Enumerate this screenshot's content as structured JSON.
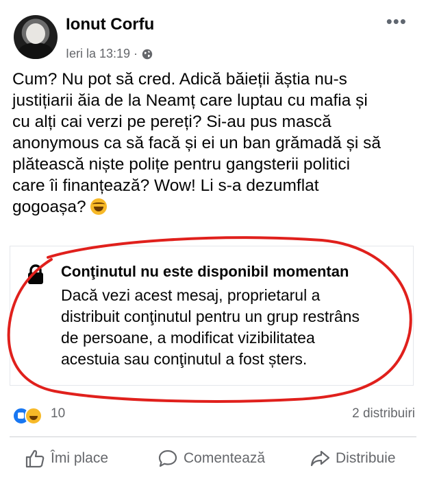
{
  "post": {
    "author": "Ionut Corfu",
    "timestamp": "Ieri la 13:19 ·",
    "more_label": "•••",
    "text_lines": [
      "Cum? Nu pot să cred. Adică băieții ăștia nu-s",
      "justițiarii ăia de la Neamț care luptau cu mafia și",
      "cu alți cai verzi pe pereți? Si-au pus mască",
      "anonymous ca să facă și ei un ban grămadă și să",
      "plătească niște polițe pentru gangsterii politici",
      "care îi finanțează? Wow! Li s-a dezumflat",
      "gogoașa?"
    ],
    "emoji_icon": "laughing-tears-emoji"
  },
  "unavailable": {
    "title": "Conţinutul nu este disponibil momentan",
    "body_lines": [
      "Dacă vezi acest mesaj, proprietarul a",
      "distribuit conţinutul pentru un grup restrâns",
      "de persoane, a modificat vizibilitatea",
      "acestuia sau conţinutul a fost șters."
    ],
    "annotation_color": "#e0201c"
  },
  "stats": {
    "reactions_count": "10",
    "shares": "2 distribuiri"
  },
  "actions": {
    "like": "Îmi place",
    "comment": "Comentează",
    "share": "Distribuie"
  },
  "colors": {
    "secondary_text": "#65676b",
    "like_blue": "#1877f2",
    "haha_yellow": "#f7b928"
  }
}
